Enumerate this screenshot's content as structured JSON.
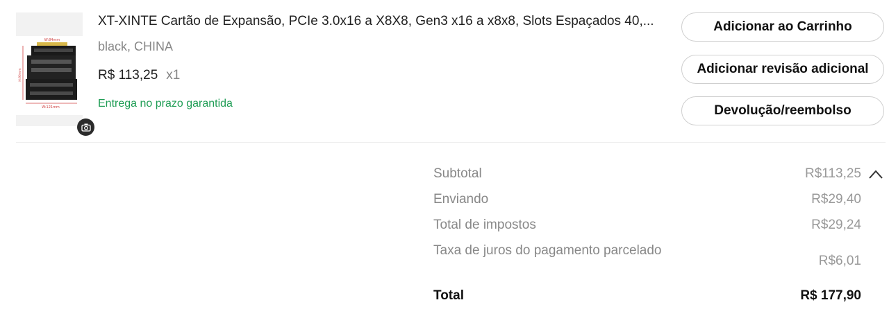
{
  "item": {
    "title": "XT-XINTE Cartão de Expansão, PCIe 3.0x16 a X8X8, Gen3 x16 a x8x8, Slots Espaçados 40,...",
    "variant": "black, CHINA",
    "price": "R$ 113,25",
    "quantity": "x1",
    "delivery": "Entrega no prazo garantida",
    "image_labels": {
      "top": "W:84mm",
      "side": "H:90mm",
      "bottom": "W:121mm"
    },
    "icon": "camera-icon"
  },
  "actions": {
    "add_to_cart": "Adicionar ao Carrinho",
    "add_review": "Adicionar revisão adicional",
    "refund": "Devolução/reembolso"
  },
  "summary": {
    "subtotal_label": "Subtotal",
    "subtotal_value": "R$113,25",
    "shipping_label": "Enviando",
    "shipping_value": "R$29,40",
    "tax_label": "Total de impostos",
    "tax_value": "R$29,24",
    "installment_label": "Taxa de juros do pagamento parcelado",
    "installment_value": "R$6,01",
    "total_label": "Total",
    "total_value": "R$ 177,90",
    "collapse_icon": "chevron-up-icon"
  },
  "colors": {
    "delivery_green": "#1f9d55",
    "muted": "#888888"
  }
}
